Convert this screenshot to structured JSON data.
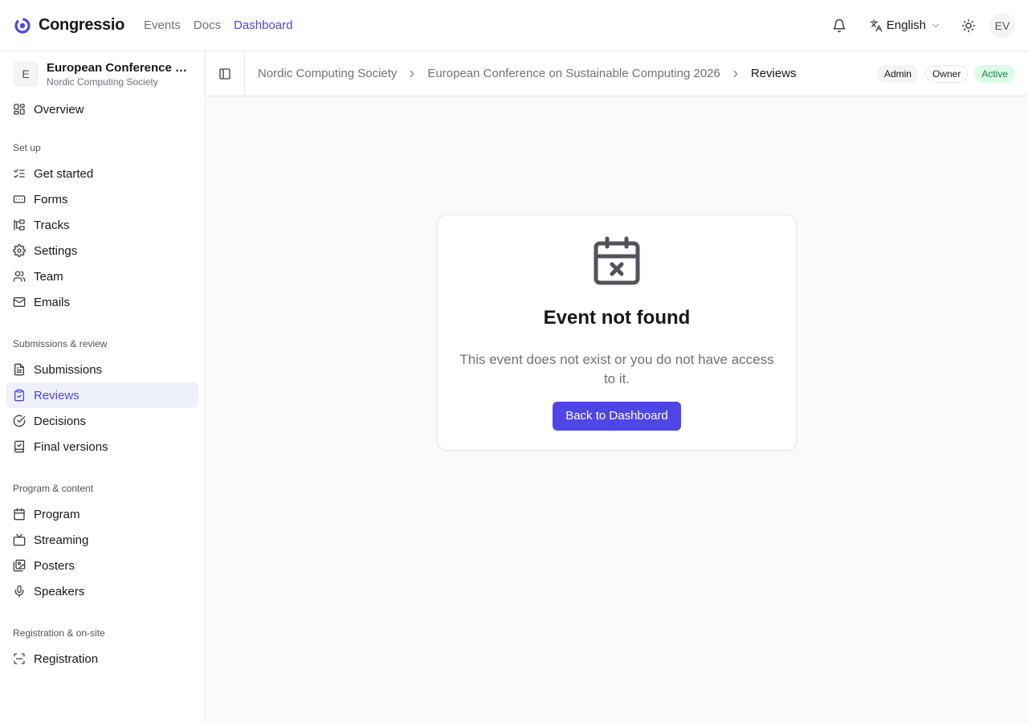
{
  "app": {
    "name": "Congressio"
  },
  "topnav": [
    {
      "label": "Events",
      "active": false
    },
    {
      "label": "Docs",
      "active": false
    },
    {
      "label": "Dashboard",
      "active": true
    }
  ],
  "header": {
    "language": "English",
    "avatar_initials": "EV"
  },
  "event": {
    "badge": "E",
    "name": "European Conference on Sustainable Computing 2026",
    "org": "Nordic Computing Society"
  },
  "sidebar": {
    "overview": "Overview",
    "groups": [
      {
        "label": "Set up",
        "items": [
          "Get started",
          "Forms",
          "Tracks",
          "Settings",
          "Team",
          "Emails"
        ]
      },
      {
        "label": "Submissions & review",
        "items": [
          "Submissions",
          "Reviews",
          "Decisions",
          "Final versions"
        ]
      },
      {
        "label": "Program & content",
        "items": [
          "Program",
          "Streaming",
          "Posters",
          "Speakers"
        ]
      },
      {
        "label": "Registration & on-site",
        "items": [
          "Registration"
        ]
      }
    ],
    "active_item": "Reviews"
  },
  "breadcrumb": [
    "Nordic Computing Society",
    "European Conference on Sustainable Computing 2026",
    "Reviews"
  ],
  "role_badges": {
    "admin": "Admin",
    "owner": "Owner",
    "status": "Active"
  },
  "empty_state": {
    "title": "Event not found",
    "description": "This event does not exist or you do not have access to it.",
    "button": "Back to Dashboard",
    "icon": "calendar-x-icon"
  },
  "colors": {
    "accent": "#4f46e5",
    "status_active_bg": "#dcfce7",
    "status_active_text": "#15803d"
  }
}
